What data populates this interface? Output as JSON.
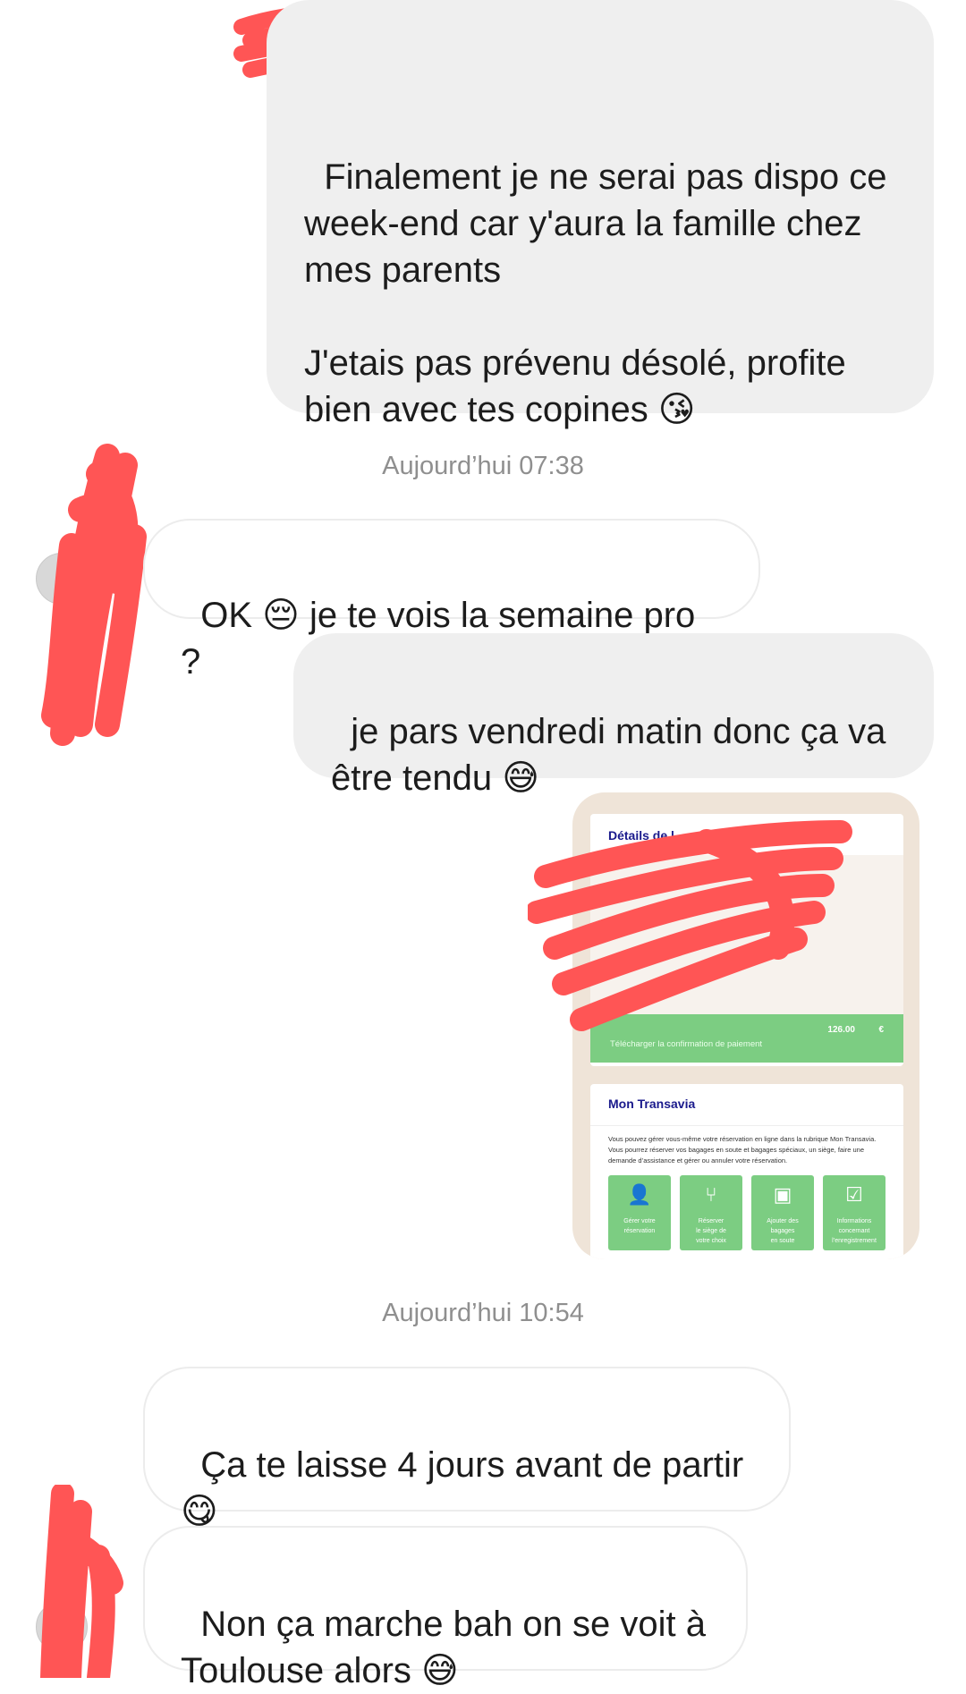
{
  "messages": [
    {
      "id": "m1",
      "direction": "sent",
      "text": "Finalement je ne serai pas dispo ce week-end car y'aura la famille chez mes parents\n\nJ'etais pas prévenu désolé, profite bien avec tes copines 😘"
    },
    {
      "id": "t1",
      "type": "timestamp",
      "text": "Aujourd’hui 07:38"
    },
    {
      "id": "m2",
      "direction": "received",
      "text": "OK 😔 je te vois la semaine pro ?"
    },
    {
      "id": "m3",
      "direction": "sent",
      "text": "je pars vendredi matin donc ça va être tendu 😅"
    },
    {
      "id": "t2",
      "type": "timestamp",
      "text": "Aujourd’hui 10:54"
    },
    {
      "id": "m4",
      "direction": "received",
      "text": "Ça te laisse 4 jours avant de partir 😋"
    },
    {
      "id": "m5",
      "direction": "received",
      "text": "Non ça marche bah on se voit à Toulouse alors 😅"
    }
  ],
  "attachment": {
    "panel1_title": "Détails de l",
    "price": "126.00",
    "currency": "€",
    "download_label": "Télécharger la confirmation de paiement",
    "panel2_title": "Mon Transavia",
    "panel2_text": "Vous pouvez gérer vous-même votre réservation en ligne dans la rubrique Mon Transavia. Vous pourrez réserver vos bagages en soute et bagages spéciaux, un siège, faire une demande d’assistance et gérer ou annuler votre réservation.",
    "tiles": [
      {
        "icon": "ticket-icon",
        "glyph": "👤",
        "label": "Gérer votre\nréservation"
      },
      {
        "icon": "seat-icon",
        "glyph": "⑂",
        "label": "Réserver\nle siège de\nvotre choix"
      },
      {
        "icon": "luggage-icon",
        "glyph": "▣",
        "label": "Ajouter des\nbagages\nen soute"
      },
      {
        "icon": "laptop-check-icon",
        "glyph": "☑",
        "label": "Informations\nconcernant\nl’enregistrement"
      }
    ]
  },
  "colors": {
    "sent_bubble": "#efefef",
    "received_border": "#ececec",
    "redaction": "#ff5555",
    "transavia_green": "#7ccd82",
    "transavia_blue": "#1a1a8c"
  }
}
